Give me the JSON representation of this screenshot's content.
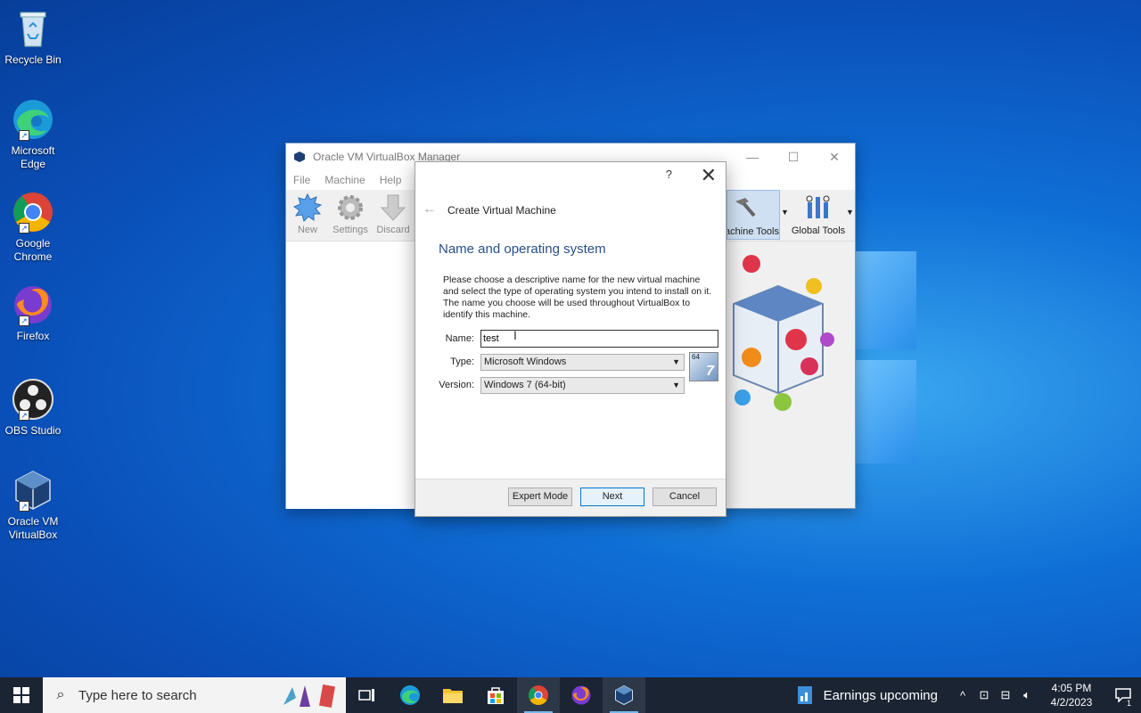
{
  "desktop": {
    "icons": [
      {
        "label": "Recycle Bin",
        "icon": "recycle-bin-icon"
      },
      {
        "label": "Microsoft Edge",
        "icon": "edge-icon"
      },
      {
        "label": "Google Chrome",
        "icon": "chrome-icon"
      },
      {
        "label": "Firefox",
        "icon": "firefox-icon"
      },
      {
        "label": "OBS Studio",
        "icon": "obs-icon"
      },
      {
        "label": "Oracle VM VirtualBox",
        "icon": "virtualbox-icon"
      }
    ]
  },
  "vbox": {
    "title": "Oracle VM VirtualBox Manager",
    "menu": [
      "File",
      "Machine",
      "Help"
    ],
    "toolbar": {
      "new": "New",
      "settings": "Settings",
      "discard": "Discard",
      "machine_tools": "Machine Tools",
      "global_tools": "Global Tools"
    }
  },
  "dialog": {
    "help": "?",
    "title": "Create Virtual Machine",
    "heading": "Name and operating system",
    "description": "Please choose a descriptive name for the new virtual machine and select the type of operating system you intend to install on it. The name you choose will be used throughout VirtualBox to identify this machine.",
    "name_label": "Name:",
    "name_value": "test",
    "type_label": "Type:",
    "type_value": "Microsoft Windows",
    "version_label": "Version:",
    "version_value": "Windows 7 (64-bit)",
    "os_badge_bits": "64",
    "os_badge_num": "7",
    "buttons": {
      "expert": "Expert Mode",
      "next": "Next",
      "cancel": "Cancel"
    }
  },
  "taskbar": {
    "search_placeholder": "Type here to search",
    "news": "Earnings upcoming",
    "time": "4:05 PM",
    "date": "4/2/2023",
    "notification_count": "1"
  },
  "colors": {
    "accent": "#0078d7",
    "heading": "#2a4f8a",
    "taskbar": "#1b2433"
  }
}
